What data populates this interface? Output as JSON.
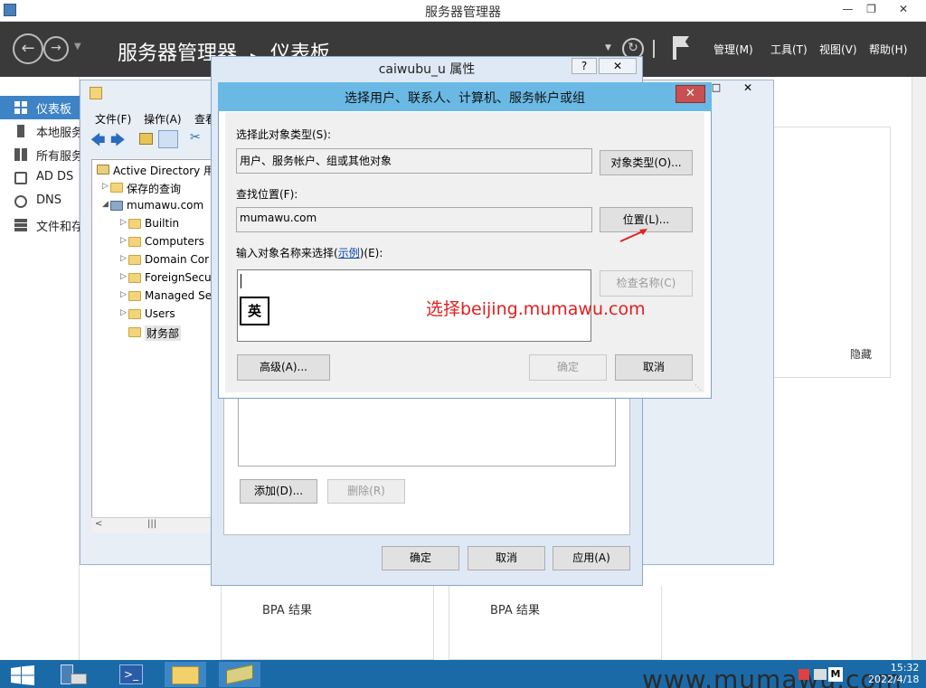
{
  "server_manager": {
    "window_title": "服务器管理器",
    "breadcrumb": [
      "服务器管理器",
      "仪表板"
    ],
    "menus": [
      "管理(M)",
      "工具(T)",
      "视图(V)",
      "帮助(H)"
    ],
    "nav": [
      {
        "label": "仪表板",
        "icon": "dashboard-icon",
        "active": true
      },
      {
        "label": "本地服务器",
        "icon": "server-icon",
        "active": false
      },
      {
        "label": "所有服务器",
        "icon": "servers-icon",
        "active": false
      },
      {
        "label": "AD DS",
        "icon": "ad-ds-icon",
        "active": false
      },
      {
        "label": "DNS",
        "icon": "dns-icon",
        "active": false
      },
      {
        "label": "文件和存储服务",
        "icon": "file-storage-icon",
        "active": false
      }
    ],
    "hide_label": "隐藏",
    "bpa_labels": [
      "BPA 结果",
      "BPA 结果"
    ]
  },
  "aduc": {
    "menus": [
      "文件(F)",
      "操作(A)",
      "查看"
    ],
    "tree": [
      {
        "label": "Active Directory 用",
        "indent": 0,
        "arrow": "",
        "icon": "ad-root-icon"
      },
      {
        "label": "保存的查询",
        "indent": 1,
        "arrow": "▷",
        "icon": "folder-icon"
      },
      {
        "label": "mumawu.com",
        "indent": 1,
        "arrow": "◢",
        "icon": "domain-icon"
      },
      {
        "label": "Builtin",
        "indent": 2,
        "arrow": "▷",
        "icon": "folder-icon"
      },
      {
        "label": "Computers",
        "indent": 2,
        "arrow": "▷",
        "icon": "folder-icon"
      },
      {
        "label": "Domain Cor",
        "indent": 2,
        "arrow": "▷",
        "icon": "ou-icon"
      },
      {
        "label": "ForeignSecu",
        "indent": 2,
        "arrow": "▷",
        "icon": "folder-icon"
      },
      {
        "label": "Managed Se",
        "indent": 2,
        "arrow": "▷",
        "icon": "folder-icon"
      },
      {
        "label": "Users",
        "indent": 2,
        "arrow": "▷",
        "icon": "folder-icon"
      },
      {
        "label": "财务部",
        "indent": 2,
        "arrow": "",
        "icon": "ou-icon",
        "selected": true
      }
    ]
  },
  "props": {
    "title": "caiwubu_u 属性",
    "add_button": "添加(D)...",
    "remove_button": "删除(R)",
    "ok": "确定",
    "cancel": "取消",
    "apply": "应用(A)"
  },
  "select_dialog": {
    "title": "选择用户、联系人、计算机、服务帐户或组",
    "object_type_label": "选择此对象类型(S):",
    "object_type_value": "用户、服务帐户、组或其他对象",
    "object_type_button": "对象类型(O)...",
    "location_label": "查找位置(F):",
    "location_value": "mumawu.com",
    "location_button": "位置(L)...",
    "names_label_prefix": "输入对象名称来选择(",
    "names_label_link": "示例",
    "names_label_suffix": ")(E):",
    "check_names_button": "检查名称(C)",
    "advanced_button": "高级(A)...",
    "ok": "确定",
    "cancel": "取消",
    "ime_indicator": "英"
  },
  "annotation": "选择beijing.mumawu.com",
  "taskbar": {
    "watermark": "www.mumawu.com",
    "time": "15:32",
    "date": "2022/4/18"
  },
  "colors": {
    "accent": "#3d83c5",
    "dialog_titlebar": "#6ab9e5",
    "annotation": "#e02020",
    "taskbar": "#1a6aa8"
  }
}
